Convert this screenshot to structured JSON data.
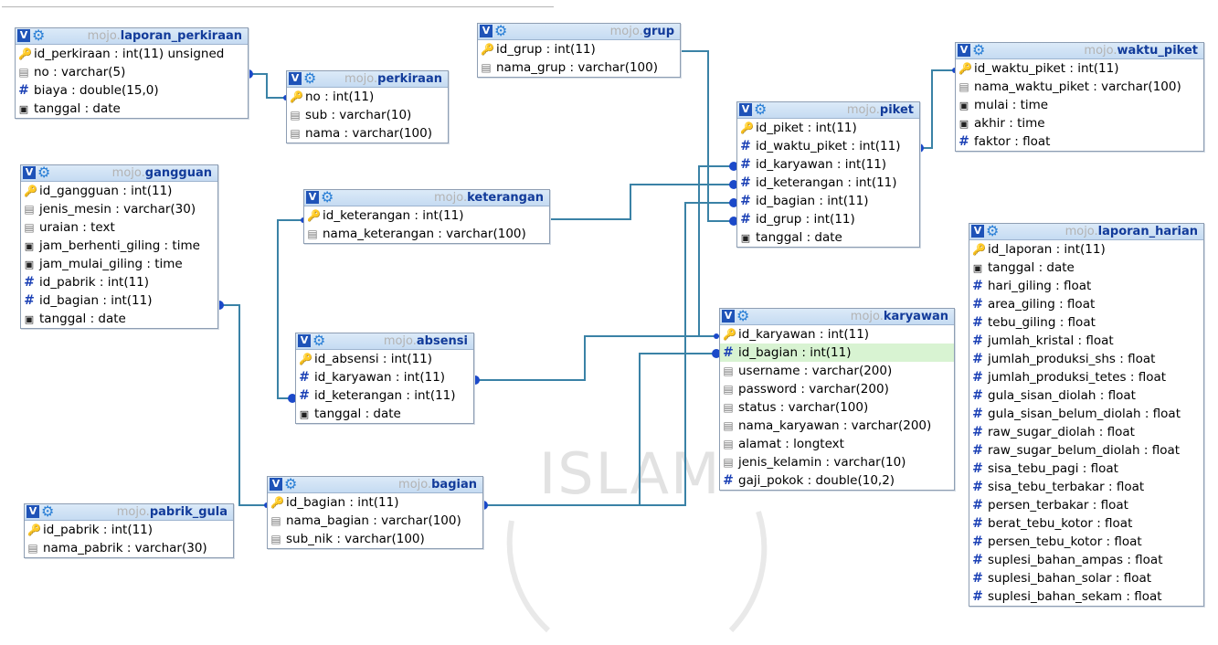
{
  "schema": "mojo",
  "tables": {
    "laporan_perkiraan": {
      "schema": "mojo.",
      "name": "laporan_perkiraan",
      "fields": [
        {
          "icon": "key-icon",
          "text": "id_perkiraan : int(11) unsigned"
        },
        {
          "icon": "string-icon",
          "text": "no : varchar(5)"
        },
        {
          "icon": "numeric-icon",
          "text": "biaya : double(15,0)"
        },
        {
          "icon": "date-icon",
          "text": "tanggal : date"
        }
      ]
    },
    "perkiraan": {
      "schema": "mojo.",
      "name": "perkiraan",
      "fields": [
        {
          "icon": "key-icon",
          "text": "no : int(11)"
        },
        {
          "icon": "string-icon",
          "text": "sub : varchar(10)"
        },
        {
          "icon": "string-icon",
          "text": "nama : varchar(100)"
        }
      ]
    },
    "grup": {
      "schema": "mojo.",
      "name": "grup",
      "fields": [
        {
          "icon": "key-icon",
          "text": "id_grup : int(11)"
        },
        {
          "icon": "string-icon",
          "text": "nama_grup : varchar(100)"
        }
      ]
    },
    "waktu_piket": {
      "schema": "mojo.",
      "name": "waktu_piket",
      "fields": [
        {
          "icon": "key-icon",
          "text": "id_waktu_piket : int(11)"
        },
        {
          "icon": "string-icon",
          "text": "nama_waktu_piket : varchar(100)"
        },
        {
          "icon": "date-icon",
          "text": "mulai : time"
        },
        {
          "icon": "date-icon",
          "text": "akhir : time"
        },
        {
          "icon": "numeric-icon",
          "text": "faktor : float"
        }
      ]
    },
    "piket": {
      "schema": "mojo.",
      "name": "piket",
      "fields": [
        {
          "icon": "key-icon",
          "text": "id_piket : int(11)"
        },
        {
          "icon": "numeric-icon",
          "text": "id_waktu_piket : int(11)"
        },
        {
          "icon": "numeric-icon",
          "text": "id_karyawan : int(11)"
        },
        {
          "icon": "numeric-icon",
          "text": "id_keterangan : int(11)"
        },
        {
          "icon": "numeric-icon",
          "text": "id_bagian : int(11)"
        },
        {
          "icon": "numeric-icon",
          "text": "id_grup : int(11)"
        },
        {
          "icon": "date-icon",
          "text": "tanggal : date"
        }
      ]
    },
    "gangguan": {
      "schema": "mojo.",
      "name": "gangguan",
      "fields": [
        {
          "icon": "key-icon",
          "text": "id_gangguan : int(11)"
        },
        {
          "icon": "string-icon",
          "text": "jenis_mesin : varchar(30)"
        },
        {
          "icon": "string-icon",
          "text": "uraian : text"
        },
        {
          "icon": "date-icon",
          "text": "jam_berhenti_giling : time"
        },
        {
          "icon": "date-icon",
          "text": "jam_mulai_giling : time"
        },
        {
          "icon": "numeric-icon",
          "text": "id_pabrik : int(11)"
        },
        {
          "icon": "numeric-icon",
          "text": "id_bagian : int(11)"
        },
        {
          "icon": "date-icon",
          "text": "tanggal : date"
        }
      ]
    },
    "keterangan": {
      "schema": "mojo.",
      "name": "keterangan",
      "fields": [
        {
          "icon": "key-icon",
          "text": "id_keterangan : int(11)"
        },
        {
          "icon": "string-icon",
          "text": "nama_keterangan : varchar(100)"
        }
      ]
    },
    "laporan_harian": {
      "schema": "mojo.",
      "name": "laporan_harian",
      "fields": [
        {
          "icon": "key-icon",
          "text": "id_laporan : int(11)"
        },
        {
          "icon": "date-icon",
          "text": "tanggal : date"
        },
        {
          "icon": "numeric-icon",
          "text": "hari_giling : float"
        },
        {
          "icon": "numeric-icon",
          "text": "area_giling : float"
        },
        {
          "icon": "numeric-icon",
          "text": "tebu_giling : float"
        },
        {
          "icon": "numeric-icon",
          "text": "jumlah_kristal : float"
        },
        {
          "icon": "numeric-icon",
          "text": "jumlah_produksi_shs : float"
        },
        {
          "icon": "numeric-icon",
          "text": "jumlah_produksi_tetes : float"
        },
        {
          "icon": "numeric-icon",
          "text": "gula_sisan_diolah : float"
        },
        {
          "icon": "numeric-icon",
          "text": "gula_sisan_belum_diolah : float"
        },
        {
          "icon": "numeric-icon",
          "text": "raw_sugar_diolah : float"
        },
        {
          "icon": "numeric-icon",
          "text": "raw_sugar_belum_diolah : float"
        },
        {
          "icon": "numeric-icon",
          "text": "sisa_tebu_pagi : float"
        },
        {
          "icon": "numeric-icon",
          "text": "sisa_tebu_terbakar : float"
        },
        {
          "icon": "numeric-icon",
          "text": "persen_terbakar : float"
        },
        {
          "icon": "numeric-icon",
          "text": "berat_tebu_kotor : float"
        },
        {
          "icon": "numeric-icon",
          "text": "persen_tebu_kotor : float"
        },
        {
          "icon": "numeric-icon",
          "text": "suplesi_bahan_ampas : float"
        },
        {
          "icon": "numeric-icon",
          "text": "suplesi_bahan_solar : float"
        },
        {
          "icon": "numeric-icon",
          "text": "suplesi_bahan_sekam : float"
        }
      ]
    },
    "karyawan": {
      "schema": "mojo.",
      "name": "karyawan",
      "fields": [
        {
          "icon": "key-icon",
          "text": "id_karyawan : int(11)"
        },
        {
          "icon": "numeric-icon",
          "text": "id_bagian : int(11)",
          "highlight": true
        },
        {
          "icon": "string-icon",
          "text": "username : varchar(200)"
        },
        {
          "icon": "string-icon",
          "text": "password : varchar(200)"
        },
        {
          "icon": "string-icon",
          "text": "status : varchar(100)"
        },
        {
          "icon": "string-icon",
          "text": "nama_karyawan : varchar(200)"
        },
        {
          "icon": "string-icon",
          "text": "alamat : longtext"
        },
        {
          "icon": "string-icon",
          "text": "jenis_kelamin : varchar(10)"
        },
        {
          "icon": "numeric-icon",
          "text": "gaji_pokok : double(10,2)"
        }
      ]
    },
    "absensi": {
      "schema": "mojo.",
      "name": "absensi",
      "fields": [
        {
          "icon": "key-icon",
          "text": "id_absensi : int(11)"
        },
        {
          "icon": "numeric-icon",
          "text": "id_karyawan : int(11)"
        },
        {
          "icon": "numeric-icon",
          "text": "id_keterangan : int(11)"
        },
        {
          "icon": "date-icon",
          "text": "tanggal : date"
        }
      ]
    },
    "bagian": {
      "schema": "mojo.",
      "name": "bagian",
      "fields": [
        {
          "icon": "key-icon",
          "text": "id_bagian : int(11)"
        },
        {
          "icon": "string-icon",
          "text": "nama_bagian : varchar(100)"
        },
        {
          "icon": "string-icon",
          "text": "sub_nik : varchar(100)"
        }
      ]
    },
    "pabrik_gula": {
      "schema": "mojo.",
      "name": "pabrik_gula",
      "fields": [
        {
          "icon": "key-icon",
          "text": "id_pabrik : int(11)"
        },
        {
          "icon": "string-icon",
          "text": "nama_pabrik : varchar(30)"
        }
      ]
    }
  },
  "watermark": {
    "text": "ISLAM"
  },
  "colors": {
    "link": "#3a82a6",
    "connector": "#1b49c9",
    "header": "#c5dbf2",
    "highlight": "#d8f3d2"
  }
}
